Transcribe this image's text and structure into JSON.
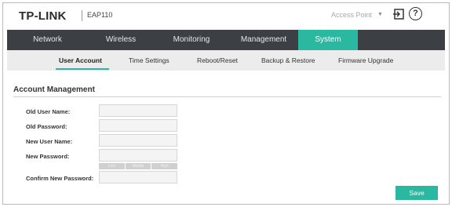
{
  "header": {
    "logo": "TP-LINK",
    "model": "EAP110",
    "mode": "Access Point",
    "help_glyph": "?"
  },
  "main_nav": {
    "tabs": [
      {
        "label": "Network",
        "active": false
      },
      {
        "label": "Wireless",
        "active": false
      },
      {
        "label": "Monitoring",
        "active": false
      },
      {
        "label": "Management",
        "active": false
      },
      {
        "label": "System",
        "active": true
      }
    ]
  },
  "sub_nav": {
    "tabs": [
      {
        "label": "User Account",
        "active": true
      },
      {
        "label": "Time Settings",
        "active": false
      },
      {
        "label": "Reboot/Reset",
        "active": false
      },
      {
        "label": "Backup & Restore",
        "active": false
      },
      {
        "label": "Firmware Upgrade",
        "active": false
      }
    ]
  },
  "account": {
    "title": "Account Management",
    "fields": [
      {
        "label": "Old User Name:",
        "value": ""
      },
      {
        "label": "Old Password:",
        "value": ""
      },
      {
        "label": "New User Name:",
        "value": ""
      },
      {
        "label": "New Password:",
        "value": ""
      },
      {
        "label": "Confirm New Password:",
        "value": ""
      }
    ],
    "strength": [
      "Low",
      "Middle",
      "High"
    ],
    "save_label": "Save"
  },
  "colors": {
    "accent": "#2ab8a1",
    "nav_bg": "#3c4045",
    "subnav_bg": "#ececec"
  },
  "icons": {
    "logout": "logout-icon",
    "help": "help-icon",
    "dropdown": "chevron-down-icon"
  }
}
